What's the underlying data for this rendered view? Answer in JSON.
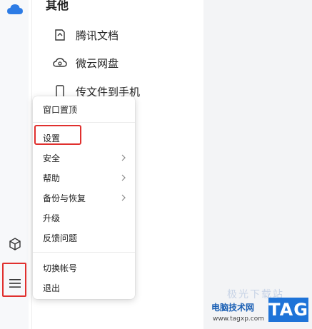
{
  "panel": {
    "section_title": "其他",
    "items": [
      {
        "label": "腾讯文档",
        "icon": "tencent-docs-icon"
      },
      {
        "label": "微云网盘",
        "icon": "weiyun-cloud-icon"
      },
      {
        "label": "传文件到手机",
        "icon": "phone-icon"
      }
    ]
  },
  "rail": {
    "top_icon": "cloud-icon",
    "bottom_icons": [
      "cube-icon",
      "hamburger-menu-icon"
    ]
  },
  "menu": {
    "items": [
      {
        "label": "窗口置顶",
        "has_submenu": false
      },
      {
        "label": "设置",
        "has_submenu": false,
        "highlighted": true
      },
      {
        "label": "安全",
        "has_submenu": true
      },
      {
        "label": "帮助",
        "has_submenu": true
      },
      {
        "label": "备份与恢复",
        "has_submenu": true
      },
      {
        "label": "升级",
        "has_submenu": false
      },
      {
        "label": "反馈问题",
        "has_submenu": false
      },
      {
        "label": "切换帐号",
        "has_submenu": false
      },
      {
        "label": "退出",
        "has_submenu": false
      }
    ]
  },
  "watermark": {
    "brand": "电脑技术网",
    "url": "www.tagxp.com",
    "tag": "TAG",
    "faded": "极光下载站"
  },
  "colors": {
    "accent_blue": "#1e73d8",
    "highlight_red": "#e0302e"
  }
}
